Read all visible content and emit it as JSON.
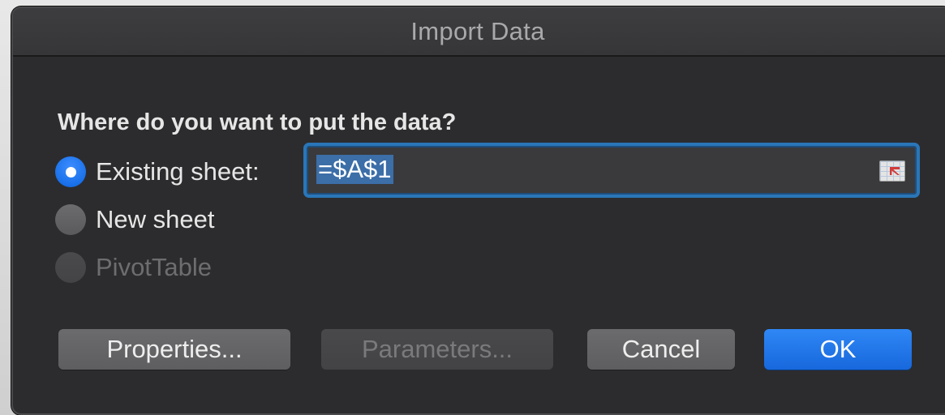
{
  "dialog": {
    "title": "Import Data",
    "question": "Where do you want to put the data?",
    "options": [
      {
        "label": "Existing sheet:",
        "state": "selected"
      },
      {
        "label": "New sheet",
        "state": "unselected"
      },
      {
        "label": "PivotTable",
        "state": "disabled"
      }
    ],
    "reference_field": {
      "value": "=$A$1",
      "icon": "collapse-dialog-icon"
    },
    "buttons": {
      "properties": "Properties...",
      "parameters": "Parameters...",
      "cancel": "Cancel",
      "ok": "OK"
    }
  },
  "colors": {
    "dialog_bg": "#2c2c2e",
    "accent": "#1768dc",
    "field_border": "#2a76b8"
  }
}
